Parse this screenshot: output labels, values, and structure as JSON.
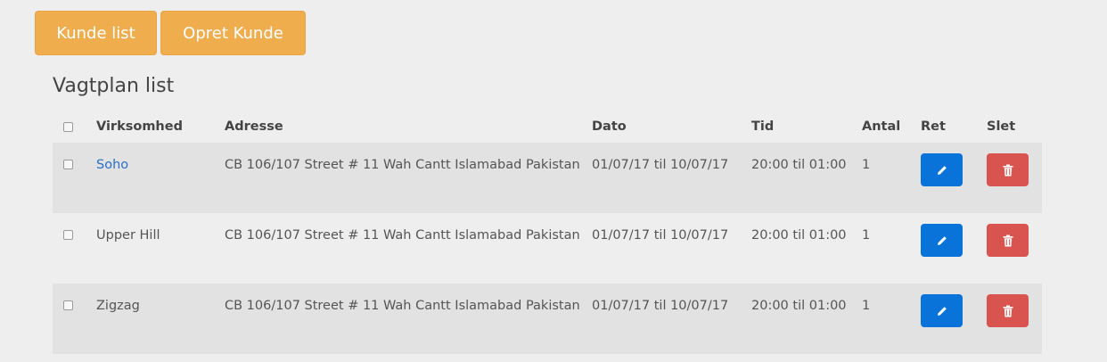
{
  "top_buttons": {
    "kunde_list": "Kunde list",
    "opret_kunde": "Opret Kunde"
  },
  "title": "Vagtplan list",
  "columns": [
    "Virksomhed",
    "Adresse",
    "Dato",
    "Tid",
    "Antal",
    "Ret",
    "Slet"
  ],
  "rows": [
    {
      "virksomhed": "Soho",
      "adresse": "CB 106/107 Street # 11 Wah Cantt Islamabad Pakistan",
      "dato": "01/07/17 til 10/07/17",
      "tid": "20:00 til 01:00",
      "antal": "1"
    },
    {
      "virksomhed": "Upper Hill",
      "adresse": "CB 106/107 Street # 11 Wah Cantt Islamabad Pakistan",
      "dato": "01/07/17 til 10/07/17",
      "tid": "20:00 til 01:00",
      "antal": "1"
    },
    {
      "virksomhed": "Zigzag",
      "adresse": "CB 106/107 Street # 11 Wah Cantt Islamabad Pakistan",
      "dato": "01/07/17 til 10/07/17",
      "tid": "20:00 til 01:00",
      "antal": "1"
    }
  ],
  "icons": {
    "edit": "pencil-icon",
    "delete": "trash-icon"
  },
  "colors": {
    "primary_button": "#f0ad4e",
    "edit_button": "#0a73d9",
    "delete_button": "#d9534f",
    "link": "#2a6fc9"
  }
}
